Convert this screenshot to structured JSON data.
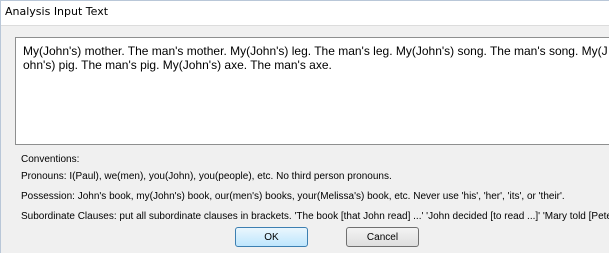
{
  "window": {
    "title": "Analysis Input Text"
  },
  "input": {
    "value": "My(John's) mother. The man's mother. My(John's) leg. The man's leg. My(John's) song. The man's song. My(John's) pig. The man's pig. My(John's) axe. The man's axe."
  },
  "conventions": {
    "heading": "Conventions:",
    "lines": [
      "Pronouns: I(Paul), we(men), you(John), you(people), etc.  No third person pronouns.",
      "Possession: John's book, my(John's) book, our(men's) books, your(Melissa's) book, etc.  Never use 'his', 'her', 'its', or 'their'.",
      "Subordinate Clauses: put all subordinate clauses in brackets.  'The book [that John read] ...' 'John decided [to read ...]' 'Mary told [Peter to"
    ]
  },
  "buttons": {
    "ok": "OK",
    "cancel": "Cancel"
  }
}
